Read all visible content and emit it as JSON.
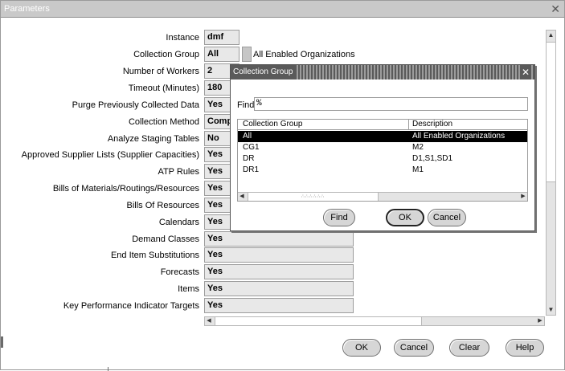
{
  "window": {
    "title": "Parameters",
    "close": "✕"
  },
  "params": [
    {
      "label": "Instance",
      "value": "dmf"
    },
    {
      "label": "Collection Group",
      "value": "All"
    },
    {
      "label": "Number of Workers",
      "value": "2"
    },
    {
      "label": "Timeout (Minutes)",
      "value": "180"
    },
    {
      "label": "Purge Previously Collected Data",
      "value": "Yes"
    },
    {
      "label": "Collection Method",
      "value": "Comp"
    },
    {
      "label": "Analyze Staging Tables",
      "value": "No"
    },
    {
      "label": "Approved Supplier Lists (Supplier Capacities)",
      "value": "Yes"
    },
    {
      "label": "ATP Rules",
      "value": "Yes"
    },
    {
      "label": "Bills of Materials/Routings/Resources",
      "value": "Yes"
    },
    {
      "label": "Bills Of Resources",
      "value": "Yes"
    },
    {
      "label": "Calendars",
      "value": "Yes"
    },
    {
      "label": "Demand Classes",
      "value": "Yes"
    },
    {
      "label": "End Item Substitutions",
      "value": "Yes"
    },
    {
      "label": "Forecasts",
      "value": "Yes"
    },
    {
      "label": "Items",
      "value": "Yes"
    },
    {
      "label": "Key Performance Indicator Targets",
      "value": "Yes"
    }
  ],
  "collection_group_desc": "All Enabled Organizations",
  "buttons": {
    "ok": "OK",
    "cancel": "Cancel",
    "clear": "Clear",
    "help": "Help"
  },
  "dialog": {
    "title": "Collection Group",
    "find_label": "Find",
    "find_value": "%",
    "columns": [
      "Collection Group",
      "Description"
    ],
    "rows": [
      {
        "group": "All",
        "description": "All Enabled Organizations"
      },
      {
        "group": "CG1",
        "description": "M2"
      },
      {
        "group": "DR",
        "description": "D1,S1,SD1"
      },
      {
        "group": "DR1",
        "description": "M1"
      }
    ],
    "selected_row": 0,
    "buttons": {
      "find": "Find",
      "ok": "OK",
      "cancel": "Cancel"
    }
  }
}
